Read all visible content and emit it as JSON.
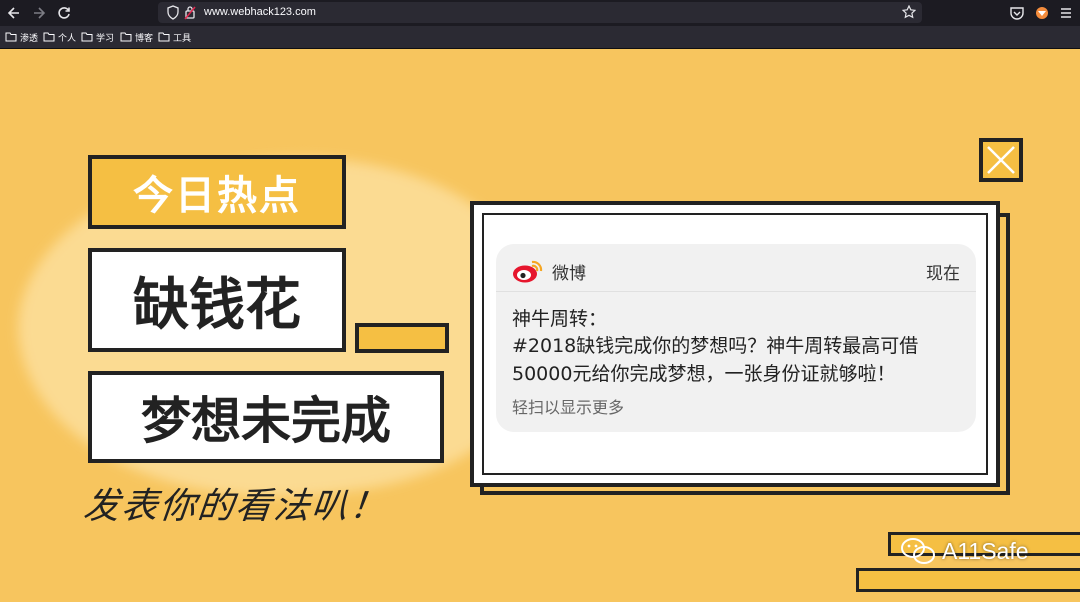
{
  "browser": {
    "url": "www.webhack123.com",
    "bookmarks": [
      "渗透",
      "个人",
      "学习",
      "博客",
      "工具"
    ]
  },
  "poster": {
    "hot_label": "今日热点",
    "short_label": "缺钱花",
    "dream_label": "梦想未完成",
    "comment_label": "发表你的看法叭！"
  },
  "notification": {
    "app": "微博",
    "time": "现在",
    "title": "神牛周转：",
    "body": "#2018缺钱完成你的梦想吗？神牛周转最高可借50000元给你完成梦想，一张身份证就够啦！",
    "more": "轻扫以显示更多"
  },
  "watermark": "A11Safe",
  "colors": {
    "accent": "#f5bf43",
    "background": "#f7c55e",
    "weibo": "#e6162d"
  }
}
